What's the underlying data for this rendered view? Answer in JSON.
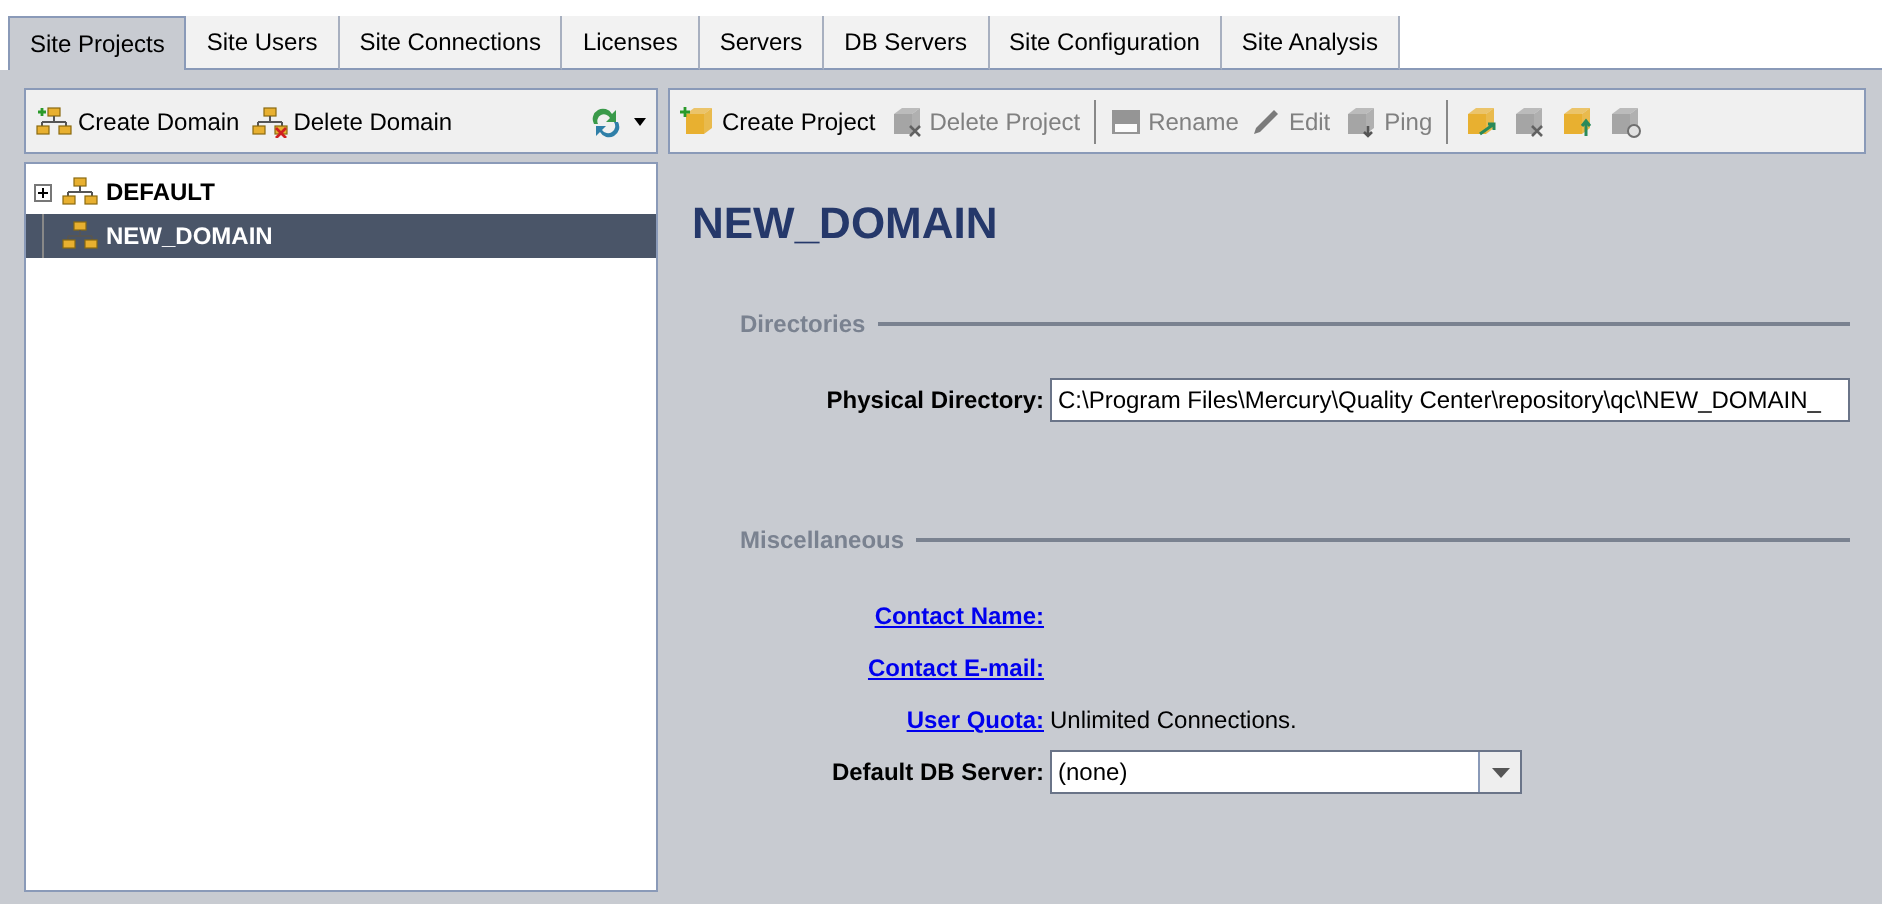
{
  "tabs": [
    {
      "label": "Site Projects",
      "selected": true
    },
    {
      "label": "Site Users",
      "selected": false
    },
    {
      "label": "Site Connections",
      "selected": false
    },
    {
      "label": "Licenses",
      "selected": false
    },
    {
      "label": "Servers",
      "selected": false
    },
    {
      "label": "DB Servers",
      "selected": false
    },
    {
      "label": "Site Configuration",
      "selected": false
    },
    {
      "label": "Site Analysis",
      "selected": false
    }
  ],
  "domain_toolbar": [
    {
      "kind": "button",
      "label": "Create Domain",
      "disabled": false
    },
    {
      "kind": "button",
      "label": "Delete Domain",
      "disabled": false
    },
    {
      "kind": "spacer"
    },
    {
      "kind": "menu",
      "disabled": false
    }
  ],
  "project_toolbar": [
    {
      "kind": "button",
      "label": "Create Project",
      "disabled": false
    },
    {
      "kind": "button",
      "label": "Delete Project",
      "disabled": true
    },
    {
      "kind": "separator"
    },
    {
      "kind": "button",
      "label": "Rename",
      "disabled": true
    },
    {
      "kind": "button",
      "label": "Edit",
      "disabled": true
    },
    {
      "kind": "button",
      "label": "Ping",
      "disabled": true
    },
    {
      "kind": "separator"
    },
    {
      "kind": "button",
      "disabled": false
    },
    {
      "kind": "button",
      "disabled": true
    },
    {
      "kind": "button",
      "disabled": false
    },
    {
      "kind": "button",
      "disabled": true
    }
  ],
  "tree": [
    {
      "label": "DEFAULT",
      "expanded": false,
      "selected": false
    },
    {
      "label": "NEW_DOMAIN",
      "selected": true
    }
  ],
  "details": {
    "title": "NEW_DOMAIN",
    "sections": [
      {
        "title": "Directories",
        "fields": [
          {
            "kind": "input",
            "label": "Physical Directory:",
            "value": "C:\\Program Files\\Mercury\\Quality Center\\repository\\qc\\NEW_DOMAIN_"
          }
        ]
      },
      {
        "title": "Miscellaneous",
        "fields": [
          {
            "kind": "link",
            "label": "Contact Name:"
          },
          {
            "kind": "link",
            "label": "Contact E-mail:"
          },
          {
            "kind": "link",
            "label": "User Quota:",
            "value": "Unlimited Connections."
          },
          {
            "kind": "select",
            "label": "Default DB Server:",
            "value": "(none)"
          }
        ]
      }
    ]
  }
}
